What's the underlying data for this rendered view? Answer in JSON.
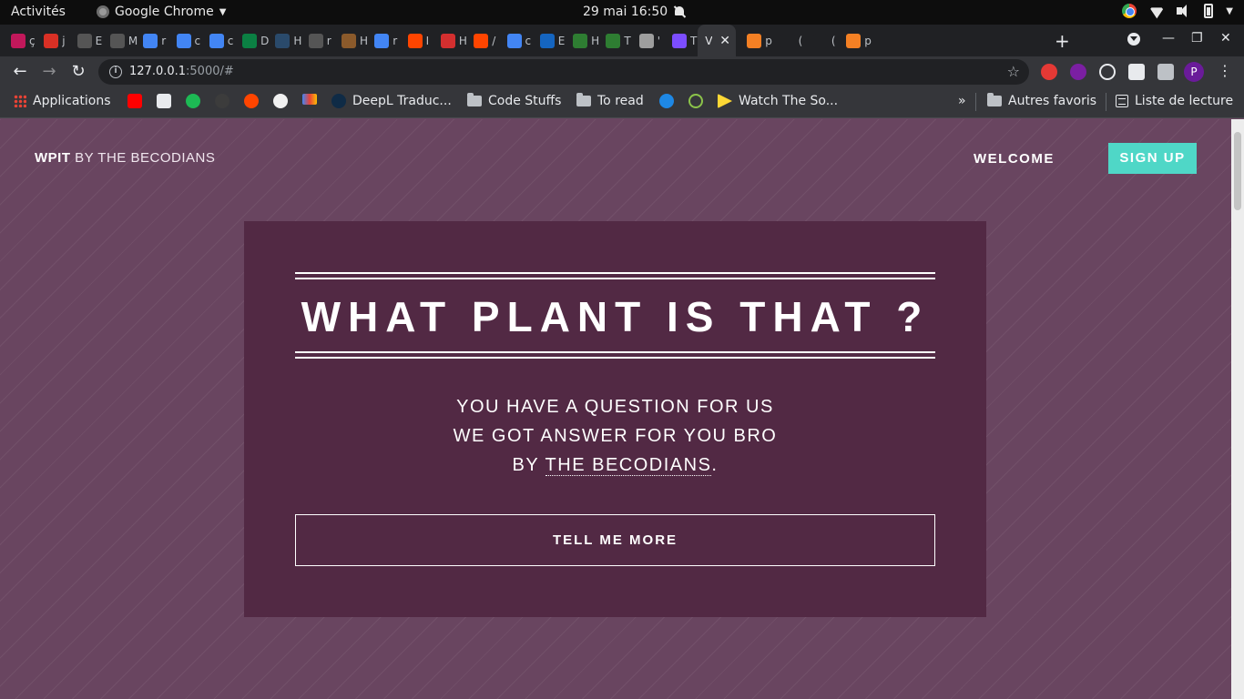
{
  "os_bar": {
    "activities": "Activités",
    "app_name": "Google Chrome",
    "clock": "29 mai  16:50"
  },
  "tabs": [
    {
      "short": "ç",
      "color": "#c2185b"
    },
    {
      "short": "j",
      "color": "#d93025"
    },
    {
      "short": "E",
      "color": "#555555"
    },
    {
      "short": "M",
      "color": "#555555"
    },
    {
      "short": "r",
      "color": "#4285f4"
    },
    {
      "short": "c",
      "color": "#4285f4"
    },
    {
      "short": "c",
      "color": "#4285f4"
    },
    {
      "short": "D",
      "color": "#0b8043"
    },
    {
      "short": "H",
      "color": "#2a4a6b"
    },
    {
      "short": "r",
      "color": "#555555"
    },
    {
      "short": "H",
      "color": "#8b5a2b"
    },
    {
      "short": "r",
      "color": "#4285f4"
    },
    {
      "short": "I",
      "color": "#ff4500"
    },
    {
      "short": "H",
      "color": "#d32f2f"
    },
    {
      "short": "/",
      "color": "#ff4500"
    },
    {
      "short": "c",
      "color": "#4285f4"
    },
    {
      "short": "E",
      "color": "#1565c0"
    },
    {
      "short": "H",
      "color": "#2e7d32"
    },
    {
      "short": "T",
      "color": "#2e7d32"
    },
    {
      "short": "'",
      "color": "#9e9e9e"
    },
    {
      "short": "T",
      "color": "#7c4dff"
    },
    {
      "short": "V",
      "color": "#35363a",
      "active": true
    },
    {
      "short": "p",
      "color": "#f48024"
    },
    {
      "short": "(",
      "color": "#202124"
    },
    {
      "short": "(",
      "color": "#202124"
    },
    {
      "short": "p",
      "color": "#f48024"
    }
  ],
  "toolbar": {
    "url_host": "127.0.0.1",
    "url_rest": ":5000/#"
  },
  "profile_initial": "P",
  "bookmarks": {
    "apps": "Applications",
    "deepl": "DeepL Traduc...",
    "code_stuffs": "Code Stuffs",
    "to_read": "To read",
    "watch": "Watch The So...",
    "overflow": "»",
    "other": "Autres favoris",
    "reading_list": "Liste de lecture"
  },
  "page": {
    "brand_bold": "WPIT",
    "brand_light": "BY THE BECODIANS",
    "nav_welcome": "WELCOME",
    "nav_signup": "SIGN UP",
    "hero_title": "WHAT PLANT IS THAT ?",
    "hero_line1": "YOU HAVE A QUESTION FOR US",
    "hero_line2": "WE GOT ANSWER FOR YOU BRO",
    "hero_line3_prefix": "BY",
    "hero_line3_link": "THE BECODIANS",
    "hero_line3_suffix": ".",
    "cta": "TELL ME MORE"
  },
  "colors": {
    "page_bg": "#694560",
    "hero_bg": "#522944",
    "accent": "#4fd7c7"
  }
}
